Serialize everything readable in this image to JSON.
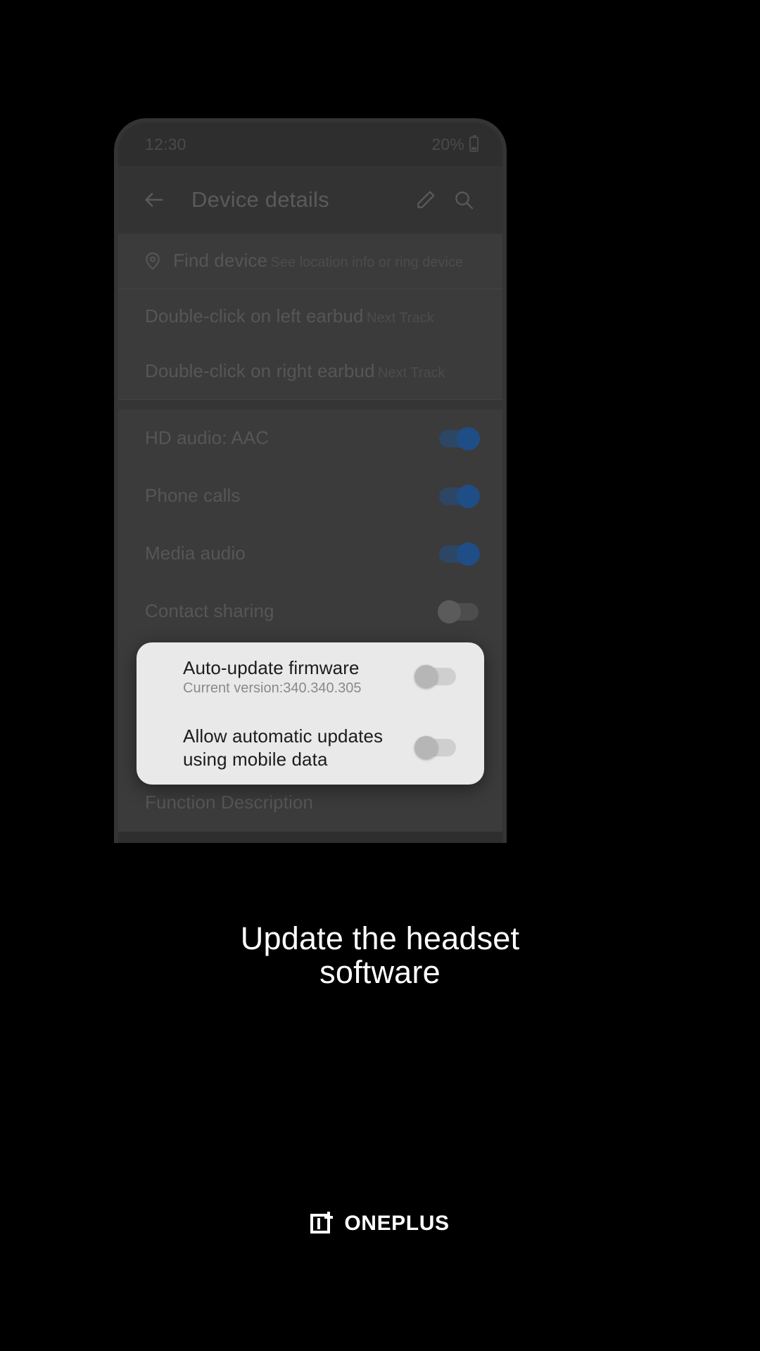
{
  "screen": {
    "background_color": "#000000",
    "surface_color": "#2e2e2e"
  },
  "status_bar": {
    "time": "12:30",
    "battery_percent": "20%",
    "battery_icon": "battery-icon"
  },
  "app_bar": {
    "back_icon": "back-arrow-icon",
    "title": "Device details",
    "edit_icon": "pencil-icon",
    "search_icon": "search-icon"
  },
  "settings_list": [
    {
      "id": "find-device",
      "icon": "location-pin-icon",
      "title": "Find device",
      "subtitle": "See location info or ring device",
      "control": "none"
    },
    {
      "id": "double-click-left-earbud",
      "title": "Double-click on left earbud",
      "subtitle": "Next Track",
      "control": "none"
    },
    {
      "id": "double-click-right-earbud",
      "title": "Double-click on right earbud",
      "subtitle": "Next Track",
      "control": "none"
    },
    {
      "id": "hd-audio",
      "title": "HD audio: AAC",
      "subtitle": "",
      "control": "toggle",
      "toggle_state": "on"
    },
    {
      "id": "phone-calls",
      "title": "Phone calls",
      "subtitle": "",
      "control": "toggle",
      "toggle_state": "on"
    },
    {
      "id": "media-audio",
      "title": "Media audio",
      "subtitle": "",
      "control": "toggle",
      "toggle_state": "on"
    },
    {
      "id": "contact-sharing",
      "title": "Contact sharing",
      "subtitle": "",
      "control": "toggle",
      "toggle_state": "off"
    }
  ],
  "highlight_card": {
    "background_color": "#e9e9e9",
    "rows": [
      {
        "id": "auto-update-firmware",
        "title": "Auto-update firmware",
        "subtitle": "Current version:340.340.305",
        "toggle_state": "off"
      },
      {
        "id": "allow-automatic-updates-mobile-data",
        "title": "Allow automatic updates using mobile data",
        "subtitle": "",
        "toggle_state": "off"
      }
    ]
  },
  "below_card": {
    "function_description_label": "Function Description"
  },
  "caption": {
    "line1": "Update the headset",
    "line2": "software",
    "color": "#ffffff"
  },
  "brand": {
    "logo_icon": "oneplus-logo-icon",
    "wordmark": "ONEPLUS"
  }
}
